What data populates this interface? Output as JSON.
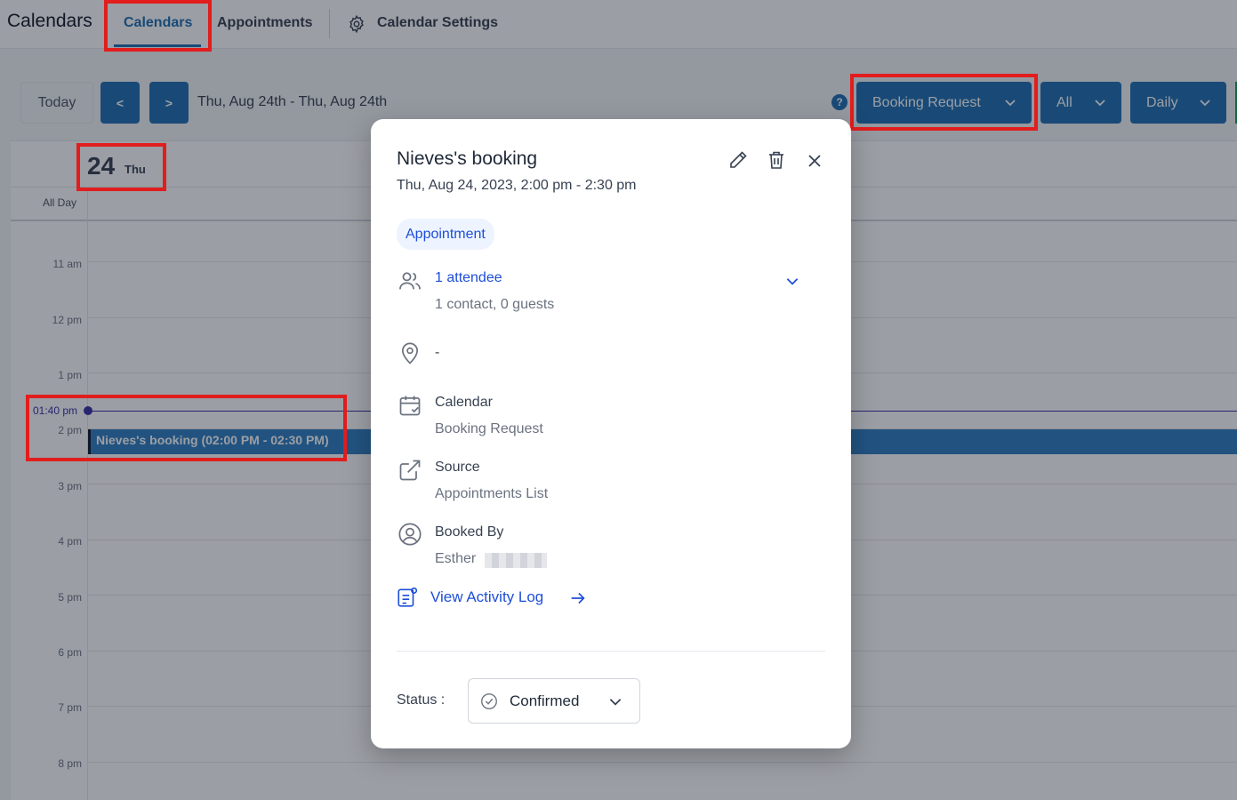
{
  "app": {
    "title": "Calendars"
  },
  "nav": {
    "tabs": [
      {
        "label": "Calendars",
        "active": true
      },
      {
        "label": "Appointments",
        "active": false
      },
      {
        "label": "Calendar Settings",
        "icon": "gear-icon",
        "active": false
      }
    ]
  },
  "toolbar": {
    "today_label": "Today",
    "prev_label": "<",
    "next_label": ">",
    "date_range": "Thu, Aug 24th - Thu, Aug 24th",
    "help_label": "?",
    "calendar_select": "Booking Request",
    "filter_select": "All",
    "view_select": "Daily"
  },
  "day": {
    "number": "24",
    "name": "Thu"
  },
  "grid": {
    "all_day_label": "All Day",
    "hours": [
      "11 am",
      "12 pm",
      "1 pm",
      "2 pm",
      "3 pm",
      "4 pm",
      "5 pm",
      "6 pm",
      "7 pm",
      "8 pm"
    ],
    "current_time": "01:40 pm"
  },
  "event": {
    "label": "Nieves's booking (02:00 PM - 02:30 PM)"
  },
  "modal": {
    "title": "Nieves's booking",
    "datetime": "Thu, Aug 24, 2023, 2:00 pm - 2:30 pm",
    "type_badge": "Appointment",
    "attendees": {
      "label": "1 attendee",
      "detail": "1 contact, 0 guests"
    },
    "location": "-",
    "calendar": {
      "label": "Calendar",
      "value": "Booking Request"
    },
    "source": {
      "label": "Source",
      "value": "Appointments List"
    },
    "booked_by": {
      "label": "Booked By",
      "value": "Esther"
    },
    "activity_log": "View Activity Log",
    "status_label": "Status :",
    "status_value": "Confirmed"
  },
  "colors": {
    "primary": "#1f6fb2",
    "event": "#2f7fc1",
    "link": "#1d4ed8",
    "highlight": "#e11d1d",
    "now_indicator": "#3730a3"
  }
}
